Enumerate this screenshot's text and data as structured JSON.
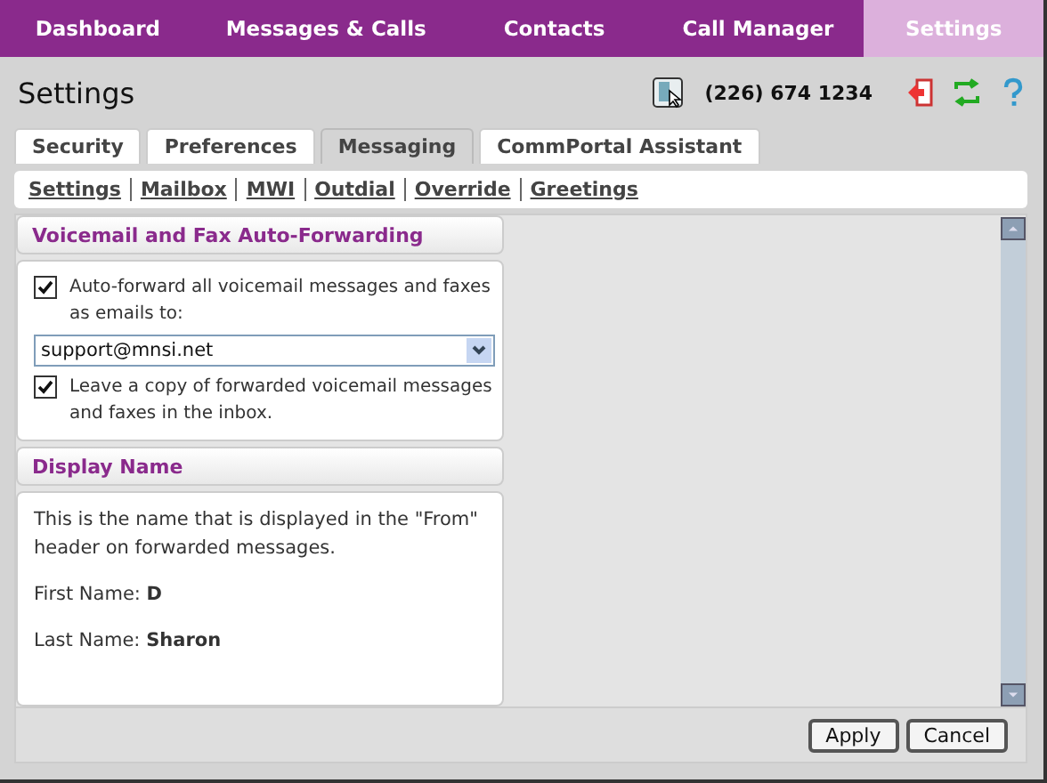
{
  "nav": [
    {
      "label": "Dashboard",
      "selected": false
    },
    {
      "label": "Messages & Calls",
      "selected": false
    },
    {
      "label": "Contacts",
      "selected": false
    },
    {
      "label": "Call Manager",
      "selected": false
    },
    {
      "label": "Settings",
      "selected": true
    }
  ],
  "page_title": "Settings",
  "phone_number": "(226) 674 1234",
  "tabs": [
    {
      "label": "Security",
      "selected": false
    },
    {
      "label": "Preferences",
      "selected": false
    },
    {
      "label": "Messaging",
      "selected": true
    },
    {
      "label": "CommPortal Assistant",
      "selected": false
    }
  ],
  "subtabs": [
    "Settings",
    "Mailbox",
    "MWI",
    "Outdial",
    "Override",
    "Greetings"
  ],
  "forwarding": {
    "title": "Voicemail and Fax Auto-Forwarding",
    "auto_forward": {
      "label": "Auto-forward all voicemail messages and faxes as emails to:",
      "checked": true
    },
    "email": "support@mnsi.net",
    "leave_copy": {
      "label": "Leave a copy of forwarded voicemail messages and faxes in the inbox.",
      "checked": true
    }
  },
  "display_name": {
    "title": "Display Name",
    "description": "This is the name that is displayed in the \"From\" header on forwarded messages.",
    "fields": [
      {
        "label": "First Name:",
        "value": "D"
      },
      {
        "label": "Last Name:",
        "value": "Sharon"
      }
    ]
  },
  "buttons": [
    "Apply",
    "Cancel"
  ]
}
